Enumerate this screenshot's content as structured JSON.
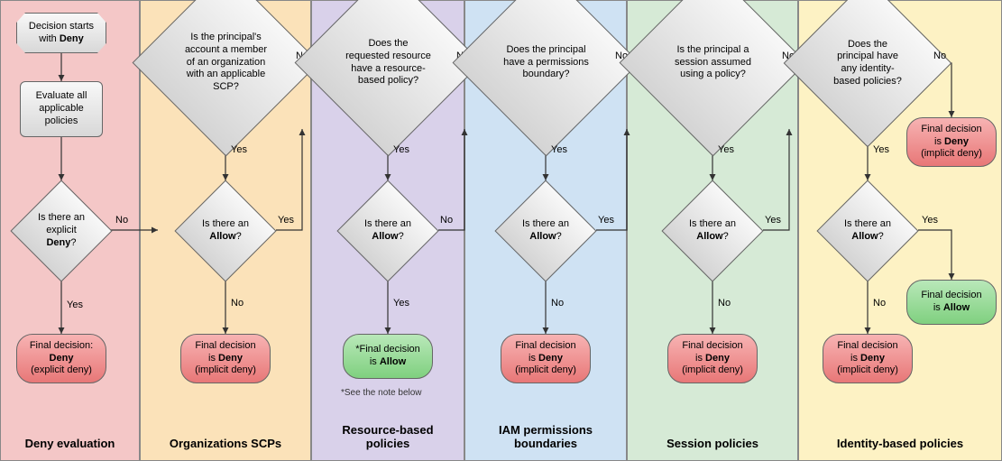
{
  "lanes": [
    {
      "label": "Deny evaluation",
      "bg": "#f4c7c7"
    },
    {
      "label": "Organizations SCPs",
      "bg": "#fbe2b9"
    },
    {
      "label": "Resource-based policies",
      "bg": "#d9d1ea"
    },
    {
      "label": "IAM permissions boundaries",
      "bg": "#cfe2f3"
    },
    {
      "label": "Session policies",
      "bg": "#d6ead6"
    },
    {
      "label": "Identity-based policies",
      "bg": "#fdf2c4"
    }
  ],
  "nodes": {
    "start": {
      "pre": "Decision starts with ",
      "bold": "Deny"
    },
    "evalAll": "Evaluate all applicable policies",
    "explicitDeny": {
      "pre": "Is there an explicit ",
      "bold": "Deny",
      "post": "?"
    },
    "scpMember": "Is the principal's account a member of an organization with an applicable SCP?",
    "resourceHas": "Does the requested resource have a resource-based policy?",
    "permBoundary": "Does the principal have a permissions boundary?",
    "sessionAssumed": "Is the principal a session assumed using a policy?",
    "identityHas": "Does the principal have any identity-based policies?",
    "allowQ": {
      "pre": "Is there an ",
      "bold": "Allow",
      "post": "?"
    },
    "finalExplicitDeny": {
      "line1_pre": "Final decision: ",
      "line1_bold": "Deny",
      "line2": "(explicit deny)"
    },
    "finalImplicitDeny": {
      "line1_pre": "Final decision is ",
      "line1_bold": "Deny",
      "line2": "(implicit deny)"
    },
    "finalAllow": {
      "pre": "Final decision is ",
      "bold": "Allow"
    },
    "finalAllowStar": {
      "pre": "*Final decision is ",
      "bold": "Allow"
    },
    "footnote": "*See the note below"
  },
  "labels": {
    "yes": "Yes",
    "no": "No"
  }
}
